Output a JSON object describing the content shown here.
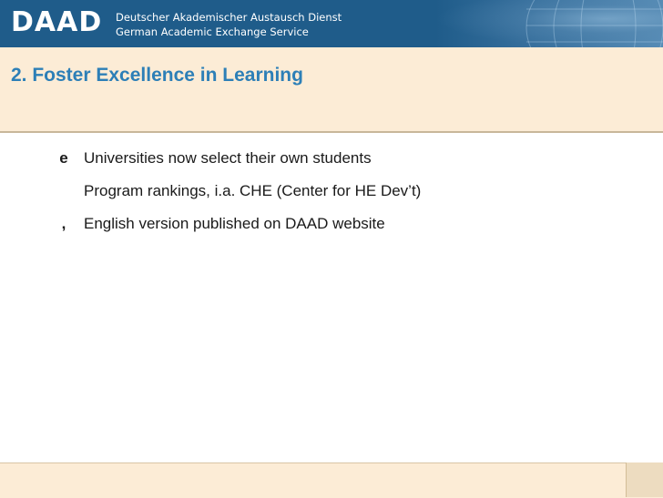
{
  "header": {
    "logo": "DAAD",
    "org_line1": "Deutscher Akademischer Austausch Dienst",
    "org_line2": "German Academic Exchange Service",
    "background_color": "#1f5c8a"
  },
  "slide": {
    "title": "2. Foster Excellence in Learning",
    "title_color": "#2d7fb7",
    "band_color": "#fcecd6",
    "bullets": [
      {
        "marker": "e",
        "text": "Universities now select their own students"
      },
      {
        "marker": "",
        "text": "Program rankings, i.a. CHE (Center for HE Dev’t)"
      },
      {
        "marker": ",",
        "text": "English version published on DAAD website"
      }
    ]
  }
}
